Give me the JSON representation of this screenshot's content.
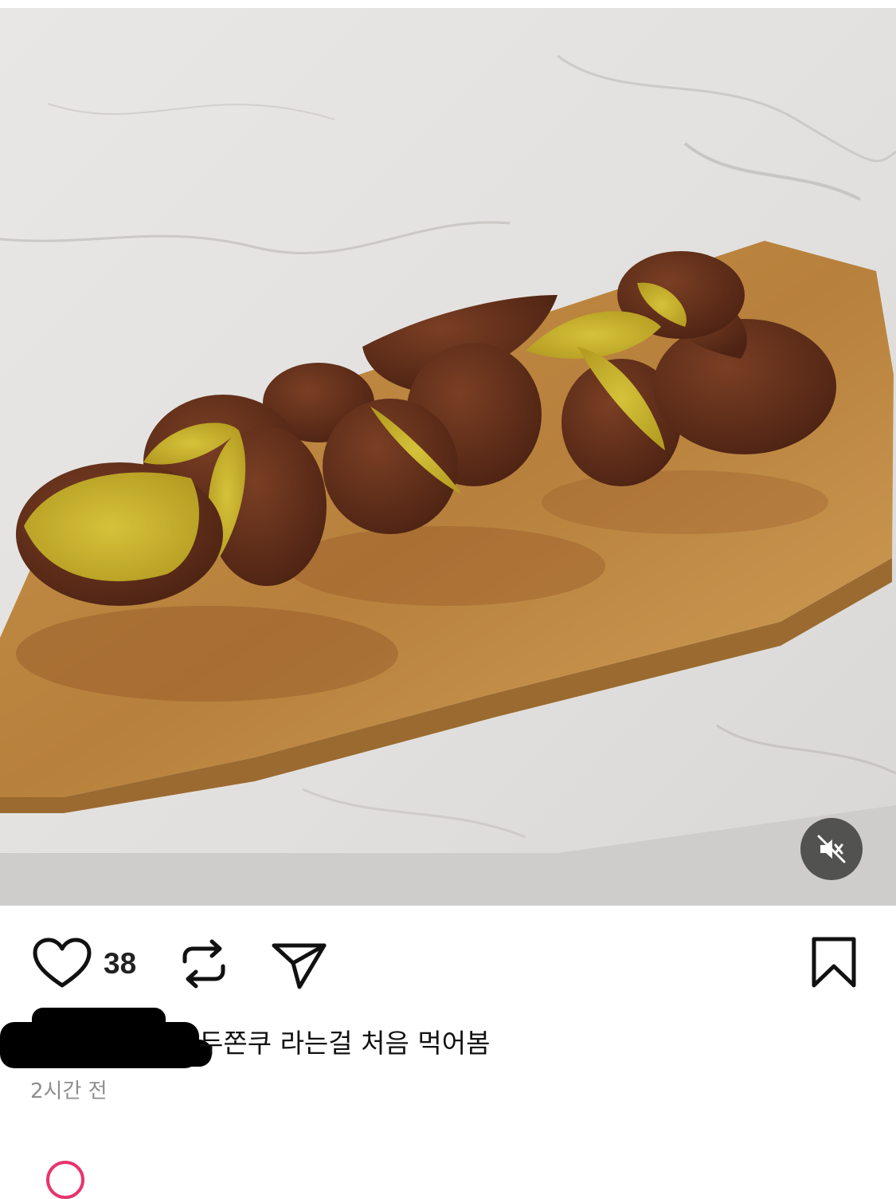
{
  "post": {
    "media": {
      "description_icon": "photo",
      "muted": true,
      "mute_icon": "speaker-muted-icon"
    },
    "actions": {
      "like_count": "38",
      "like_icon": "heart-icon",
      "repost_icon": "repost-icon",
      "share_icon": "send-icon",
      "save_icon": "bookmark-icon"
    },
    "caption": "두쫀쿠 라는걸 처음 먹어봄",
    "timestamp": "2시간 전"
  },
  "colors": {
    "icon": "#111111",
    "mute_bg": "#3c3c3c",
    "avatar_ring": "#e8346d"
  }
}
